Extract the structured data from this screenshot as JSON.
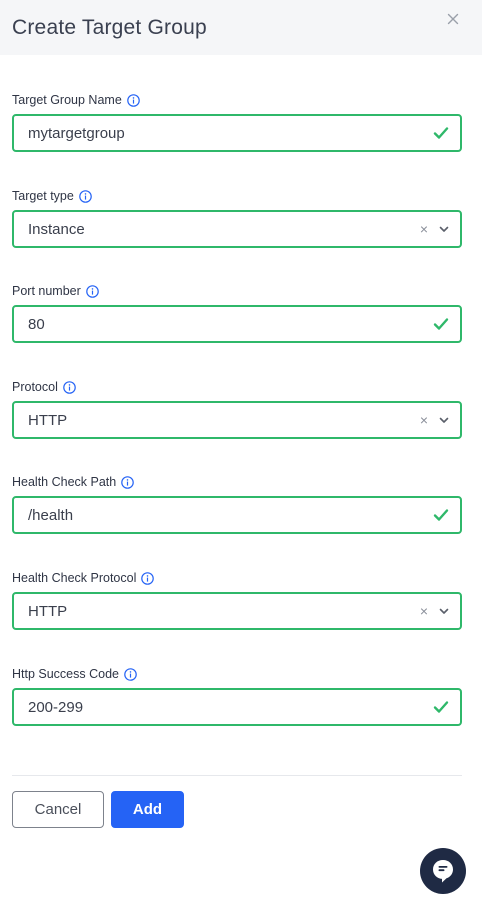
{
  "modal": {
    "title": "Create Target Group"
  },
  "fields": [
    {
      "label": "Target Group Name",
      "value": "mytargetgroup",
      "type": "text"
    },
    {
      "label": "Target type",
      "value": "Instance",
      "type": "select",
      "clear": "×"
    },
    {
      "label": "Port number",
      "value": "80",
      "type": "text"
    },
    {
      "label": "Protocol",
      "value": "HTTP",
      "type": "select",
      "clear": "×"
    },
    {
      "label": "Health Check Path",
      "value": "/health",
      "type": "text"
    },
    {
      "label": "Health Check Protocol",
      "value": "HTTP",
      "type": "select",
      "clear": "×"
    },
    {
      "label": "Http Success Code",
      "value": "200-299",
      "type": "text"
    }
  ],
  "actions": {
    "cancel_label": "Cancel",
    "add_label": "Add"
  },
  "icons": {
    "close": "close-icon",
    "info": "info-icon",
    "valid": "check-icon",
    "dropdown": "chevron-down-icon",
    "chat": "chat-icon"
  },
  "colors": {
    "valid_border": "#2fb86a",
    "primary": "#2563f5",
    "info": "#2563f5",
    "chat_bg": "#1f2a44"
  }
}
